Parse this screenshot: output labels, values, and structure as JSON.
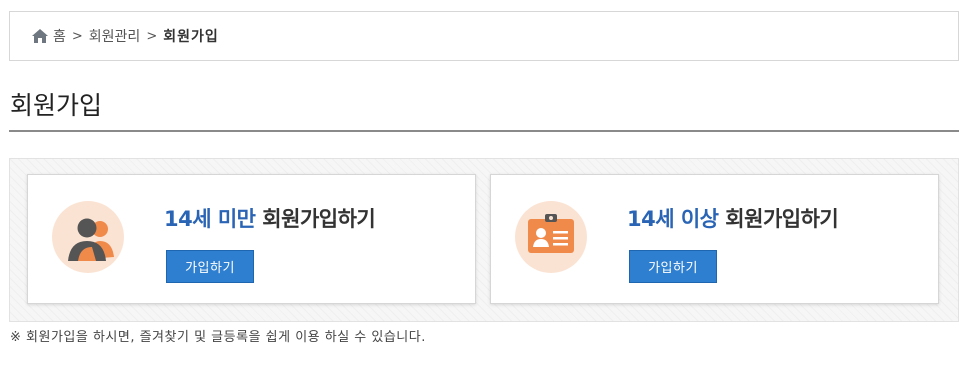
{
  "breadcrumb": {
    "home": "홈",
    "separator": ">",
    "section": "회원관리",
    "current": "회원가입"
  },
  "page_title": "회원가입",
  "cards": [
    {
      "age": "14세 미만",
      "label": " 회원가입하기",
      "button": "가입하기",
      "icon": "users-group-icon"
    },
    {
      "age": "14세 이상",
      "label": " 회원가입하기",
      "button": "가입하기",
      "icon": "id-card-icon"
    }
  ],
  "notice": "※ 회원가입을 하시면, 즐겨찾기 및 글등록을 쉽게 이용 하실 수 있습니다.",
  "colors": {
    "accent_blue": "#2a64b5",
    "button_blue": "#2f7fd0",
    "icon_orange": "#f08a4b",
    "icon_bg": "#fbe3d3",
    "icon_dark": "#555555"
  }
}
